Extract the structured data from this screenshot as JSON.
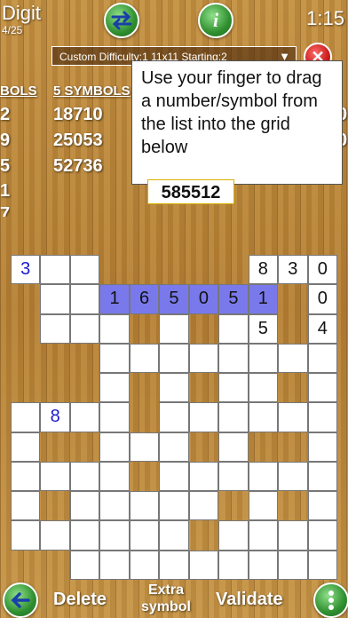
{
  "header": {
    "title": "Digit",
    "progress": "4/25",
    "timer": "1:15",
    "swap_icon": "swap-arrows-icon",
    "info_icon": "info-icon",
    "info_label": "i"
  },
  "settings": {
    "text": "Custom  Difficulty:1  11x11  Starting:2",
    "dropdown_icon": "▼",
    "close_label": "✕"
  },
  "number_list": {
    "col_left_header": "BOLS",
    "col_left": [
      "2",
      "9",
      "5",
      "1",
      "7"
    ],
    "col_mid_header": "5 SYMBOLS",
    "col_mid": [
      "18710",
      "25053",
      "52736"
    ],
    "col_right": [
      "0",
      "0"
    ]
  },
  "hint": {
    "text": "Use your finger to drag a number/symbol from the list into the grid below"
  },
  "selected_number": "585512",
  "grid": {
    "rows": [
      [
        {
          "v": "3",
          "blue": true
        },
        {
          "v": ""
        },
        {
          "v": ""
        },
        null,
        null,
        null,
        null,
        null,
        {
          "v": "8"
        },
        {
          "v": "3"
        },
        {
          "v": "0"
        }
      ],
      [
        null,
        {
          "v": ""
        },
        {
          "v": ""
        },
        {
          "v": "1",
          "hl": true
        },
        {
          "v": "6",
          "hl": true
        },
        {
          "v": "5",
          "hl": true
        },
        {
          "v": "0",
          "hl": true
        },
        {
          "v": "5",
          "hl": true
        },
        {
          "v": "1",
          "hl": true
        },
        null,
        {
          "v": "0"
        }
      ],
      [
        null,
        {
          "v": ""
        },
        {
          "v": ""
        },
        {
          "v": ""
        },
        null,
        {
          "v": ""
        },
        null,
        {
          "v": ""
        },
        {
          "v": "5"
        },
        null,
        {
          "v": "4"
        }
      ],
      [
        null,
        null,
        null,
        {
          "v": ""
        },
        {
          "v": ""
        },
        {
          "v": ""
        },
        {
          "v": ""
        },
        {
          "v": ""
        },
        {
          "v": ""
        },
        {
          "v": ""
        },
        {
          "v": ""
        }
      ],
      [
        null,
        null,
        null,
        {
          "v": ""
        },
        null,
        {
          "v": ""
        },
        null,
        {
          "v": ""
        },
        {
          "v": ""
        },
        null,
        {
          "v": ""
        }
      ],
      [
        {
          "v": ""
        },
        {
          "v": "8",
          "blue": true
        },
        {
          "v": ""
        },
        {
          "v": ""
        },
        null,
        {
          "v": ""
        },
        {
          "v": ""
        },
        {
          "v": ""
        },
        {
          "v": ""
        },
        {
          "v": ""
        },
        {
          "v": ""
        }
      ],
      [
        {
          "v": ""
        },
        null,
        null,
        {
          "v": ""
        },
        {
          "v": ""
        },
        {
          "v": ""
        },
        null,
        {
          "v": ""
        },
        null,
        null,
        {
          "v": ""
        }
      ],
      [
        {
          "v": ""
        },
        {
          "v": ""
        },
        {
          "v": ""
        },
        {
          "v": ""
        },
        null,
        {
          "v": ""
        },
        {
          "v": ""
        },
        {
          "v": ""
        },
        {
          "v": ""
        },
        {
          "v": ""
        },
        {
          "v": ""
        }
      ],
      [
        {
          "v": ""
        },
        null,
        {
          "v": ""
        },
        {
          "v": ""
        },
        {
          "v": ""
        },
        {
          "v": ""
        },
        {
          "v": ""
        },
        null,
        {
          "v": ""
        },
        null,
        {
          "v": ""
        }
      ],
      [
        {
          "v": ""
        },
        {
          "v": ""
        },
        {
          "v": ""
        },
        {
          "v": ""
        },
        {
          "v": ""
        },
        {
          "v": ""
        },
        null,
        {
          "v": ""
        },
        {
          "v": ""
        },
        {
          "v": ""
        },
        {
          "v": ""
        }
      ],
      [
        null,
        null,
        {
          "v": ""
        },
        {
          "v": ""
        },
        {
          "v": ""
        },
        {
          "v": ""
        },
        {
          "v": ""
        },
        {
          "v": ""
        },
        {
          "v": ""
        },
        {
          "v": ""
        },
        {
          "v": ""
        }
      ]
    ]
  },
  "footer": {
    "back_icon": "back-arrow-icon",
    "delete_label": "Delete",
    "extra_label_1": "Extra",
    "extra_label_2": "symbol",
    "validate_label": "Validate",
    "menu_icon": "more-vertical-icon"
  }
}
